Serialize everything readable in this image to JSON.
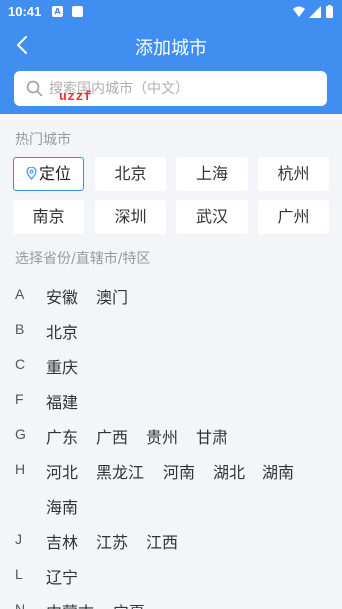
{
  "status": {
    "time": "10:41",
    "icon_a_label": "A"
  },
  "header": {
    "title": "添加城市",
    "back_icon": "back-arrow-icon"
  },
  "search": {
    "placeholder": "搜索国内城市（中文）",
    "value": "",
    "overlay_text": "uzzf"
  },
  "hot": {
    "label": "热门城市",
    "cities": [
      "定位",
      "北京",
      "上海",
      "杭州",
      "南京",
      "深圳",
      "武汉",
      "广州"
    ]
  },
  "provinces": {
    "label": "选择省份/直辖市/特区",
    "groups": [
      {
        "letter": "A",
        "items": [
          "安徽",
          "澳门"
        ]
      },
      {
        "letter": "B",
        "items": [
          "北京"
        ]
      },
      {
        "letter": "C",
        "items": [
          "重庆"
        ]
      },
      {
        "letter": "F",
        "items": [
          "福建"
        ]
      },
      {
        "letter": "G",
        "items": [
          "广东",
          "广西",
          "贵州",
          "甘肃"
        ]
      },
      {
        "letter": "H",
        "items": [
          "河北",
          "黑龙江",
          "河南",
          "湖北",
          "湖南"
        ]
      },
      {
        "letter": "",
        "items": [
          "海南"
        ]
      },
      {
        "letter": "J",
        "items": [
          "吉林",
          "江苏",
          "江西"
        ]
      },
      {
        "letter": "L",
        "items": [
          "辽宁"
        ]
      },
      {
        "letter": "N",
        "items": [
          "内蒙古",
          "宁夏"
        ]
      }
    ]
  },
  "colors": {
    "primary": "#3f8ef0",
    "background": "#f3f5f9",
    "overlay_red": "#ff2b2b"
  }
}
